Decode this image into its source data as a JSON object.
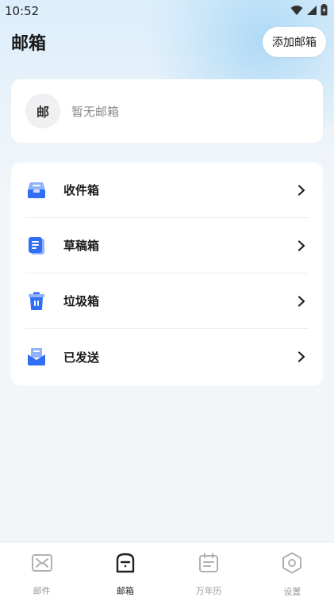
{
  "status": {
    "time": "10:52"
  },
  "header": {
    "title": "邮箱",
    "add_button": "添加邮箱"
  },
  "account": {
    "avatar_text": "邮",
    "empty_text": "暂无邮箱"
  },
  "folders": [
    {
      "label": "收件箱",
      "icon": "inbox-icon"
    },
    {
      "label": "草稿箱",
      "icon": "draft-icon"
    },
    {
      "label": "垃圾箱",
      "icon": "trash-icon"
    },
    {
      "label": "已发送",
      "icon": "sent-icon"
    }
  ],
  "tabs": [
    {
      "label": "邮件",
      "icon": "mail-icon",
      "active": false
    },
    {
      "label": "邮箱",
      "icon": "mailbox-icon",
      "active": true
    },
    {
      "label": "万年历",
      "icon": "calendar-icon",
      "active": false
    },
    {
      "label": "设置",
      "icon": "settings-icon",
      "active": false
    }
  ],
  "colors": {
    "accent": "#2f6ef5",
    "accent_light": "#8fb2fb",
    "background": "#f3f6f9"
  }
}
